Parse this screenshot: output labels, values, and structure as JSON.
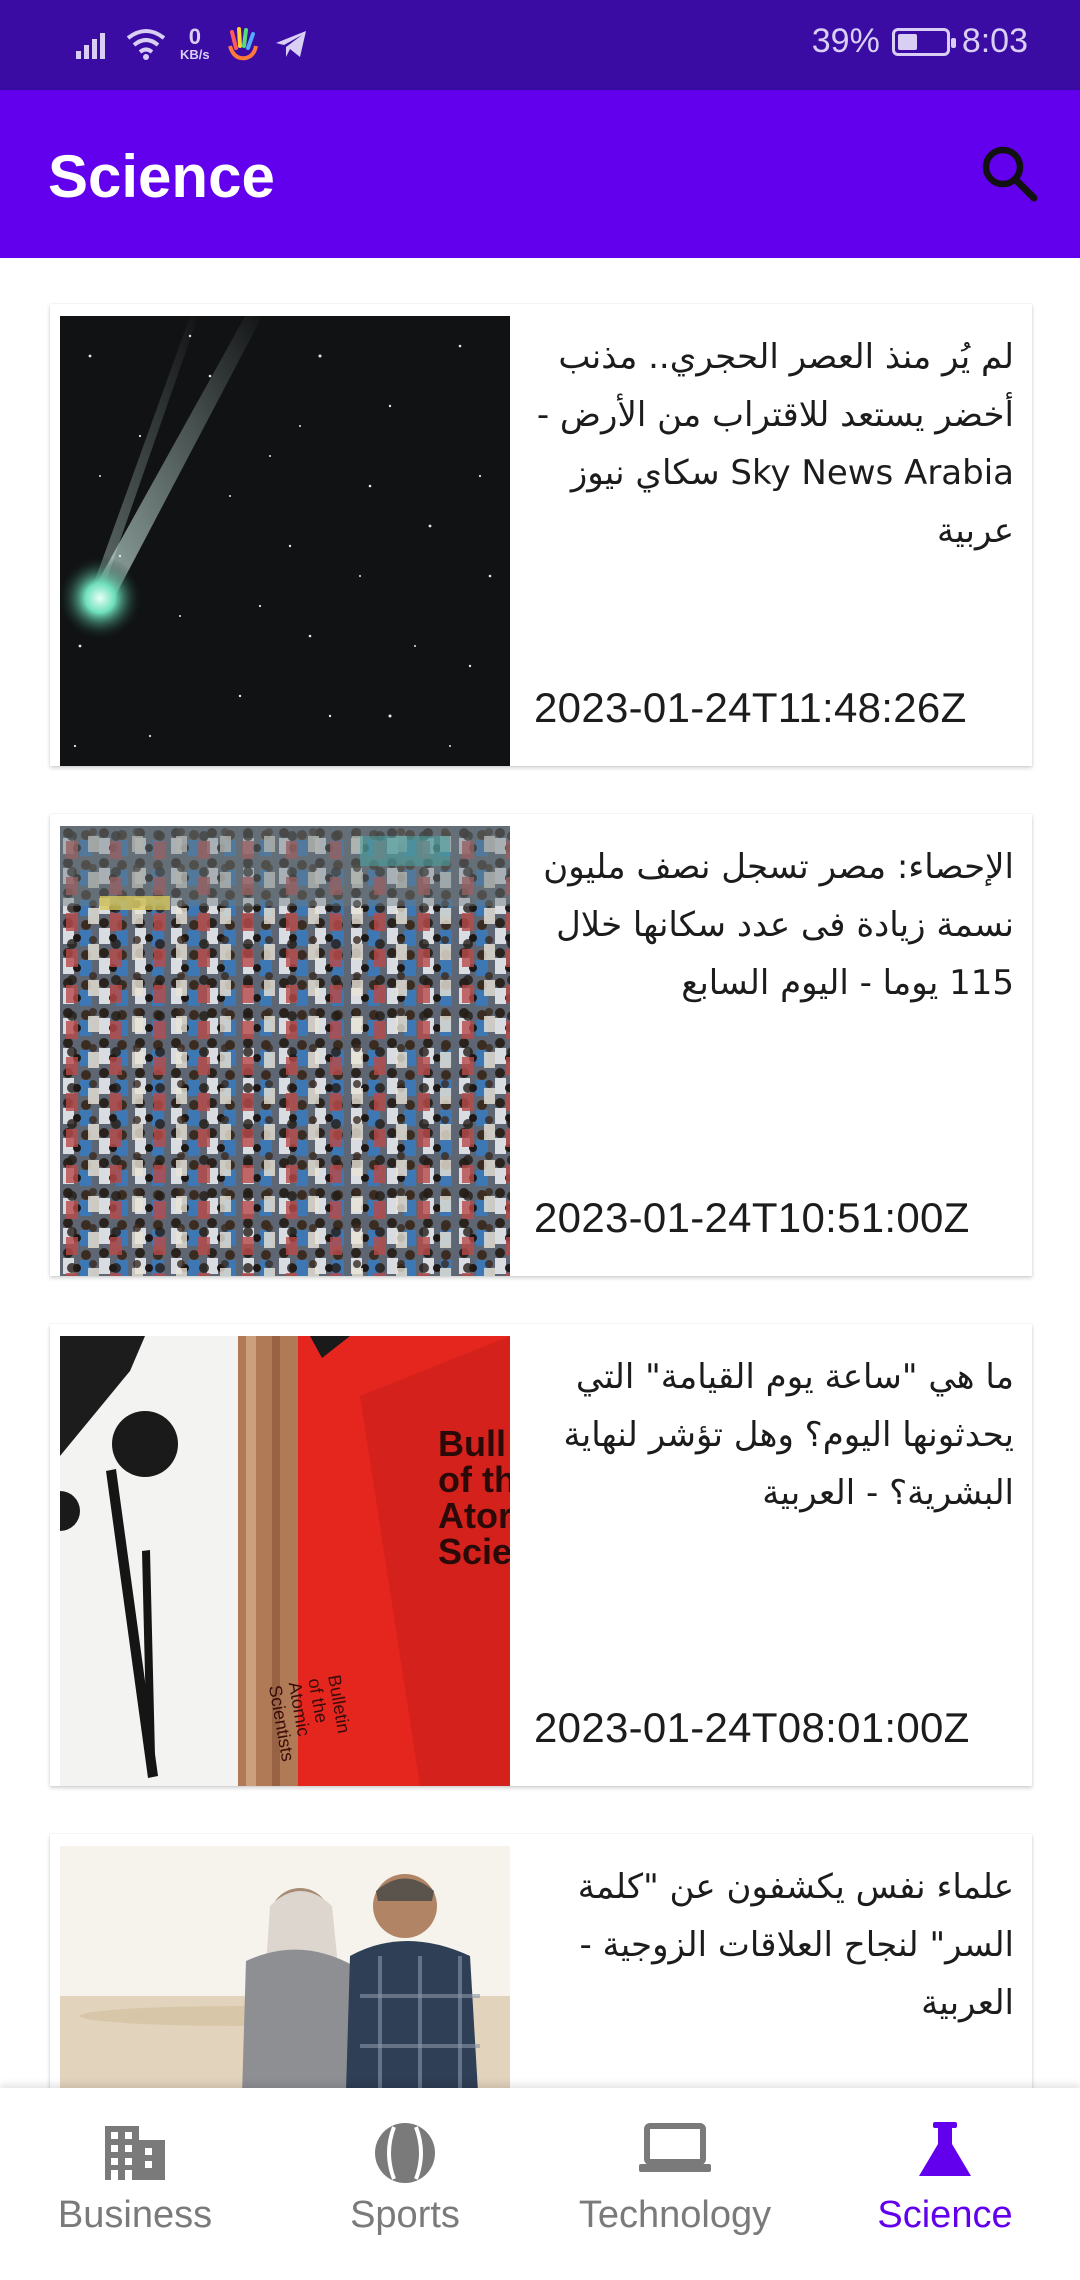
{
  "status_bar": {
    "network_speed_value": "0",
    "network_speed_unit": "KB/s",
    "battery_percent": "39%",
    "battery_level": 0.39,
    "time": "8:03"
  },
  "app_bar": {
    "title": "Science",
    "search_icon": "search-icon"
  },
  "articles": [
    {
      "headline": "لم يُر منذ العصر الحجري.. مذنب أخضر يستعد للاقتراب من الأرض - Sky News Arabia سكاي نيوز عربية",
      "published": "2023-01-24T11:48:26Z"
    },
    {
      "headline": "الإحصاء: مصر تسجل نصف مليون نسمة زيادة فى عدد سكانها خلال 115 يوما - اليوم السابع",
      "published": "2023-01-24T10:51:00Z"
    },
    {
      "headline": "ما هي \"ساعة يوم القيامة\" التي يحدثونها اليوم؟ وهل تؤشر لنهاية البشرية؟ - العربية",
      "published": "2023-01-24T08:01:00Z",
      "image_text": "Bulletin of the Atomic Scientists"
    },
    {
      "headline": "علماء نفس يكشفون عن \"كلمة السر\" لنجاح العلاقات الزوجية - العربية",
      "published": ""
    }
  ],
  "bottom_nav": {
    "accent": "#6200ee",
    "items": [
      {
        "label": "Business",
        "icon": "building-icon"
      },
      {
        "label": "Sports",
        "icon": "ball-icon"
      },
      {
        "label": "Technology",
        "icon": "laptop-icon"
      },
      {
        "label": "Science",
        "icon": "flask-icon",
        "selected": true
      }
    ]
  }
}
